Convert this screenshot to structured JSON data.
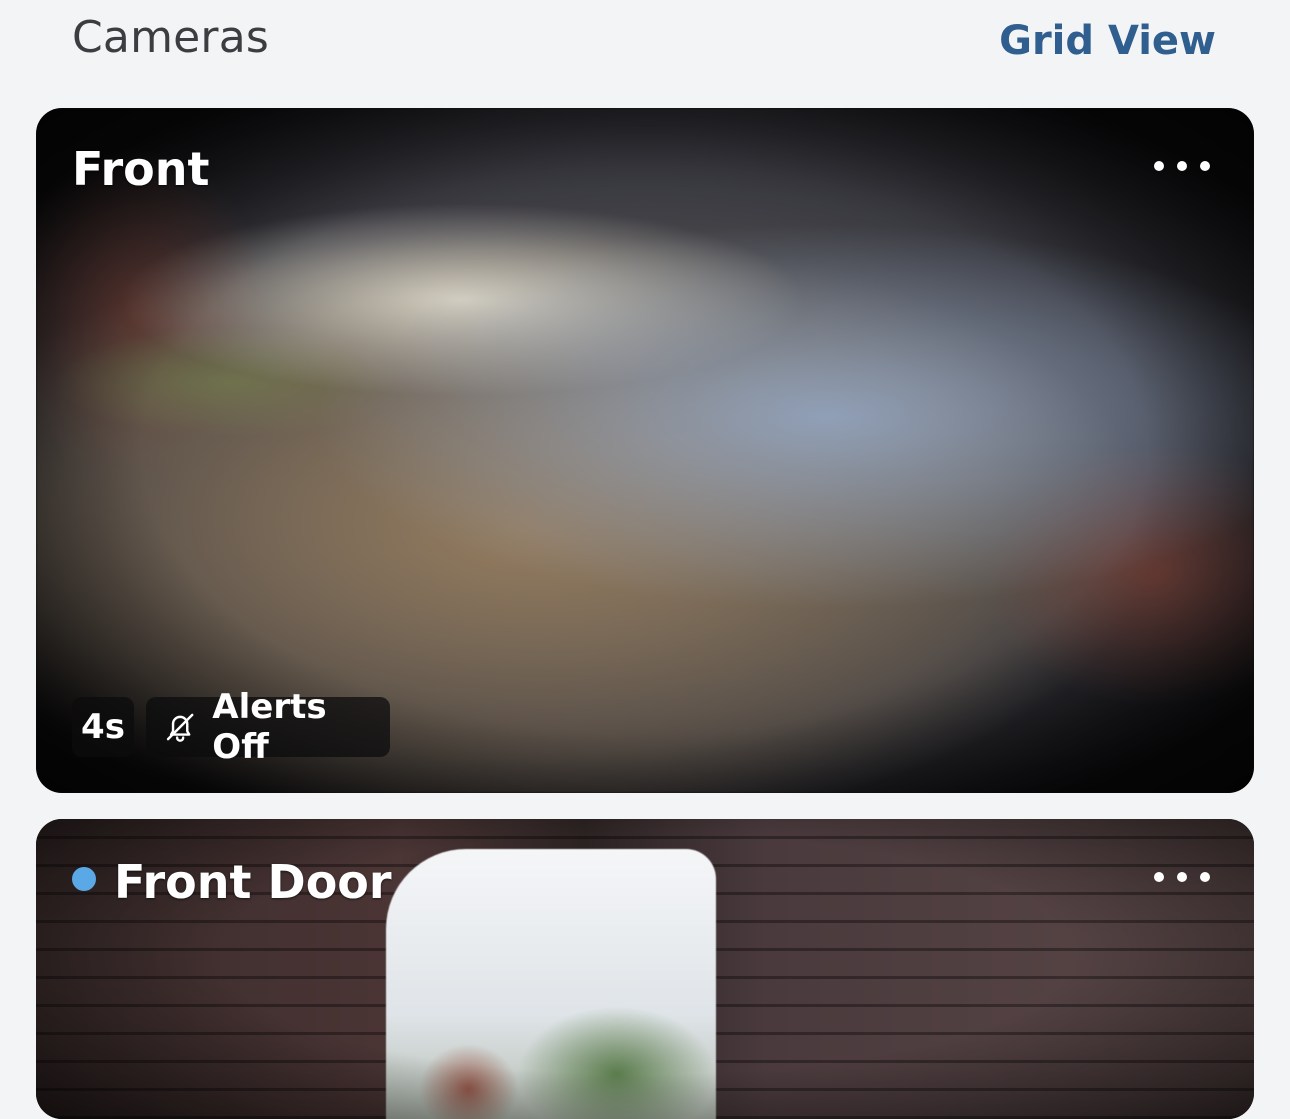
{
  "header": {
    "title": "Cameras",
    "grid_view_label": "Grid View"
  },
  "cameras": [
    {
      "name": "Front",
      "time_label": "4s",
      "alerts_label": "Alerts Off",
      "status_dot": false
    },
    {
      "name": "Front Door",
      "status_dot": true,
      "status_color": "#5aa8e6"
    }
  ],
  "icons": {
    "more": "more-horizontal-icon",
    "alerts": "bell-off-icon"
  },
  "colors": {
    "background": "#f3f4f6",
    "accent": "#2f5e8f",
    "text": "#3b3d40"
  }
}
